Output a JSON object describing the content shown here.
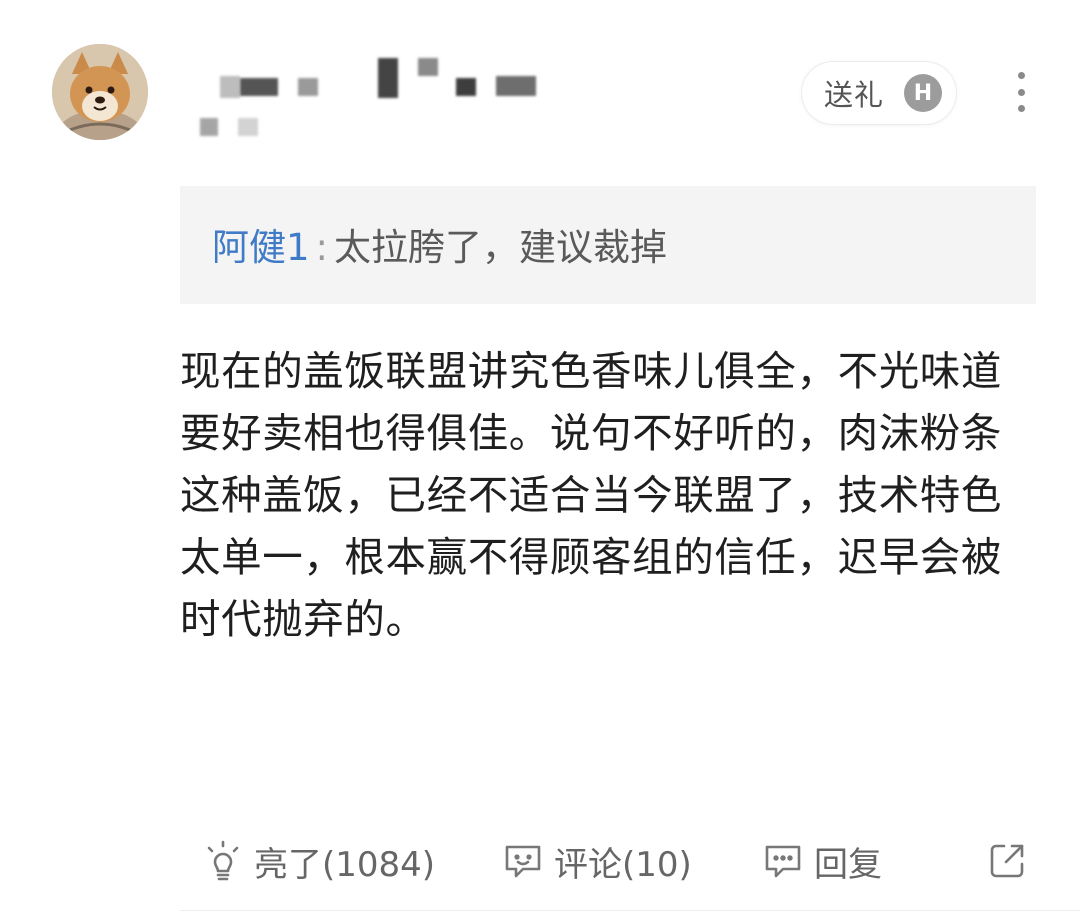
{
  "header": {
    "gift_label": "送礼",
    "gift_badge": "H"
  },
  "quote": {
    "author": "阿健1",
    "separator": ":",
    "text": "太拉胯了，建议裁掉"
  },
  "comment": {
    "text": "现在的盖饭联盟讲究色香味儿俱全，不光味道要好卖相也得俱佳。说句不好听的，肉沫粉条这种盖饭，已经不适合当今联盟了，技术特色太单一，根本赢不得顾客组的信任，迟早会被时代抛弃的。"
  },
  "actions": {
    "like_label": "亮了(1084)",
    "comment_label": "评论(10)",
    "reply_label": "回复"
  },
  "icons": {
    "like": "lightbulb-icon",
    "comment": "comment-bubble-icon",
    "reply": "reply-bubble-icon",
    "share": "share-icon",
    "more": "more-vertical-icon"
  }
}
